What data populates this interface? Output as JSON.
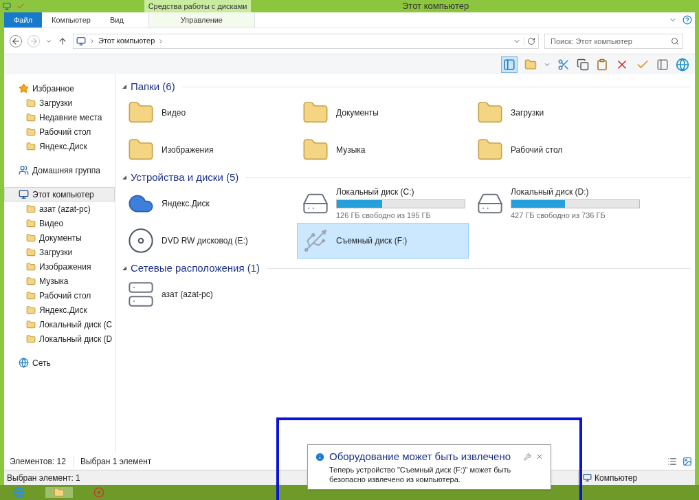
{
  "window": {
    "title": "Этот компьютер",
    "context_tab": "Средства работы с дисками"
  },
  "ribbon_tabs": [
    {
      "label": "Файл",
      "selected": true
    },
    {
      "label": "Компьютер",
      "selected": false
    },
    {
      "label": "Вид",
      "selected": false
    },
    {
      "label": "Управление",
      "selected": false
    }
  ],
  "address": {
    "path": "Этот компьютер"
  },
  "search": {
    "placeholder": "Поиск: Этот компьютер"
  },
  "sidebar": [
    {
      "label": "Избранное",
      "kind": "favorites",
      "selected": false,
      "children": [
        {
          "label": "Загрузки",
          "selected": false
        },
        {
          "label": "Недавние места",
          "selected": false
        },
        {
          "label": "Рабочий стол",
          "selected": false
        },
        {
          "label": "Яндекс.Диск",
          "selected": false
        }
      ]
    },
    {
      "label": "Домашняя группа",
      "kind": "homegroup",
      "selected": false
    },
    {
      "label": "Этот компьютер",
      "kind": "computer",
      "selected": true,
      "children": [
        {
          "label": "азат (azat-pc)",
          "selected": false
        },
        {
          "label": "Видео",
          "selected": false
        },
        {
          "label": "Документы",
          "selected": false
        },
        {
          "label": "Загрузки",
          "selected": false
        },
        {
          "label": "Изображения",
          "selected": false
        },
        {
          "label": "Музыка",
          "selected": false
        },
        {
          "label": "Рабочий стол",
          "selected": false
        },
        {
          "label": "Яндекс.Диск",
          "selected": false
        },
        {
          "label": "Локальный диск (C",
          "selected": false
        },
        {
          "label": "Локальный диск (D",
          "selected": false
        }
      ]
    },
    {
      "label": "Сеть",
      "kind": "network",
      "selected": false
    }
  ],
  "groups": [
    {
      "title": "Папки (6)",
      "items": [
        {
          "name": "Видео",
          "kind": "folder",
          "selected": false
        },
        {
          "name": "Документы",
          "kind": "folder",
          "selected": false
        },
        {
          "name": "Загрузки",
          "kind": "folder",
          "selected": false
        },
        {
          "name": "Изображения",
          "kind": "folder",
          "selected": false
        },
        {
          "name": "Музыка",
          "kind": "folder",
          "selected": false
        },
        {
          "name": "Рабочий стол",
          "kind": "folder",
          "selected": false
        }
      ]
    },
    {
      "title": "Устройства и диски (5)",
      "items": [
        {
          "name": "Яндекс.Диск",
          "kind": "cloud",
          "selected": false
        },
        {
          "name": "Локальный диск (C:)",
          "kind": "drive",
          "level": 0.354,
          "free": "126 ГБ свободно из 195 ГБ",
          "selected": false
        },
        {
          "name": "Локальный диск (D:)",
          "kind": "drive",
          "level": 0.42,
          "free": "427 ГБ свободно из 736 ГБ",
          "selected": false
        },
        {
          "name": "DVD RW дисковод (E:)",
          "kind": "dvd",
          "selected": false
        },
        {
          "name": "Съемный диск (F:)",
          "kind": "removable",
          "selected": true
        }
      ]
    },
    {
      "title": "Сетевые расположения (1)",
      "items": [
        {
          "name": "азат (azat-pc)",
          "kind": "media",
          "selected": false
        }
      ]
    }
  ],
  "status": {
    "count": "Элементов: 12",
    "selection": "Выбран 1 элемент"
  },
  "details_bar": {
    "left": "Выбран элемент: 1",
    "right": "Компьютер"
  },
  "notification": {
    "title": "Оборудование может быть извлечено",
    "body": "Теперь устройство \"Съемный диск (F:)\" может быть безопасно извлечено из компьютера."
  }
}
